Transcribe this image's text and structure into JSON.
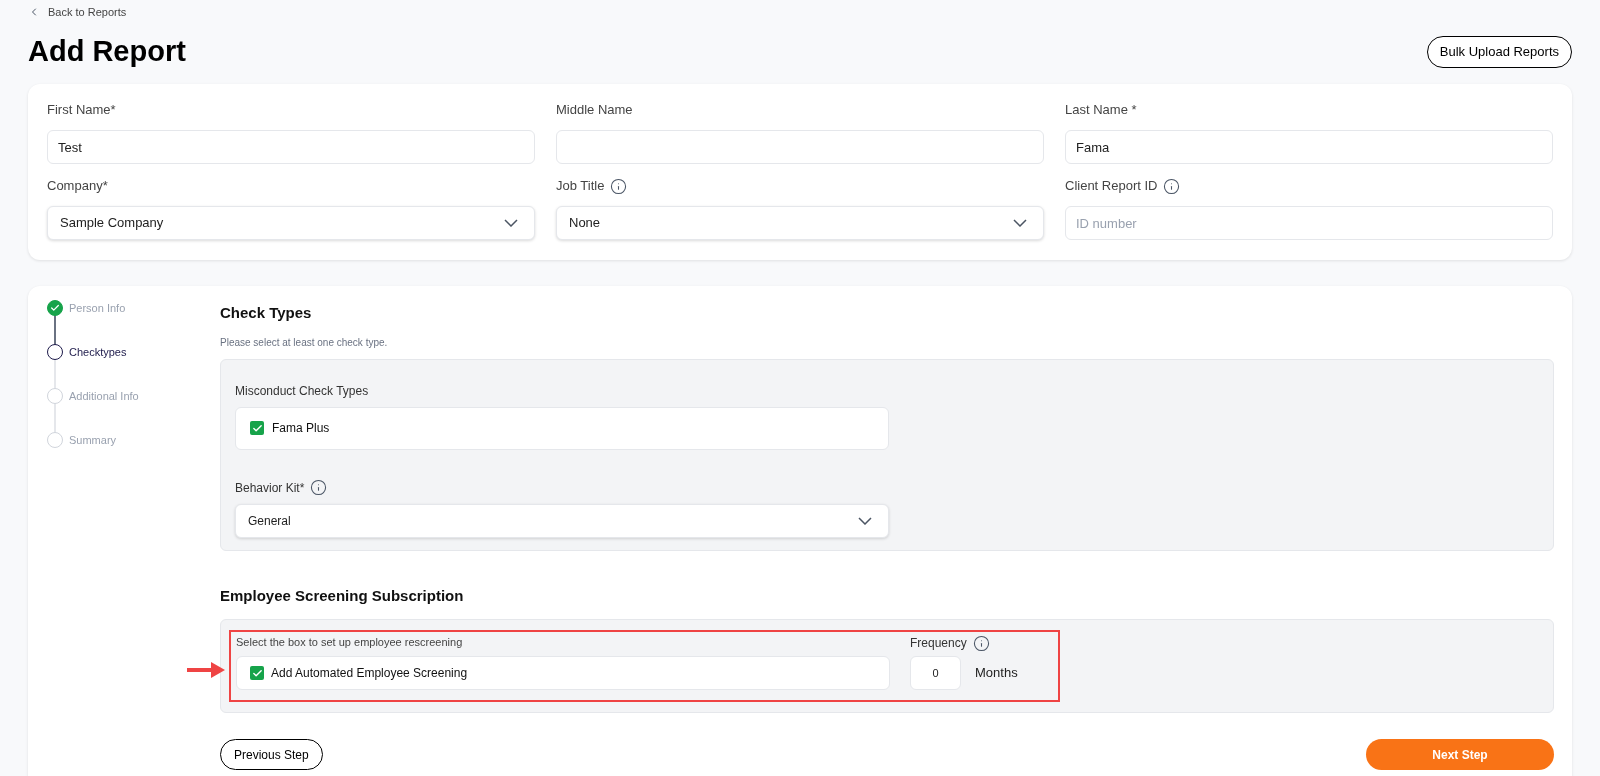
{
  "back_link": "Back to Reports",
  "title": "Add Report",
  "bulk_button": "Bulk Upload Reports",
  "person_fields": [
    {
      "label": "First Name*",
      "kind": "text",
      "value": "Test",
      "info": false
    },
    {
      "label": "Middle Name",
      "kind": "text",
      "info": false
    },
    {
      "label": "Last Name *",
      "kind": "text",
      "value": "Fama",
      "info": false
    },
    {
      "label": "Company*",
      "kind": "select",
      "value": "Sample Company",
      "info": false
    },
    {
      "label": "Job Title",
      "kind": "select",
      "value": "None",
      "info": true
    },
    {
      "label": "Client Report ID",
      "kind": "text",
      "placeholder": "ID number",
      "info": true
    }
  ],
  "steps": [
    {
      "label": "Person Info",
      "completed": true,
      "selected": false
    },
    {
      "label": "Checktypes",
      "completed": false,
      "selected": true
    },
    {
      "label": "Additional Info",
      "completed": false,
      "selected": false
    },
    {
      "label": "Summary",
      "completed": false,
      "selected": false
    }
  ],
  "check_types": {
    "heading": "Check Types",
    "hint": "Please select at least one check type.",
    "group_label": "Misconduct Check Types",
    "options": [
      {
        "label": "Fama Plus",
        "checked": true
      }
    ],
    "behavior_label": "Behavior Kit*",
    "behavior_value": "General"
  },
  "screening": {
    "heading": "Employee Screening Subscription",
    "instruction": "Select the box to set up employee rescreening",
    "option": {
      "label": "Add Automated Employee Screening",
      "checked": true
    },
    "frequency_label": "Frequency",
    "frequency_value": "0",
    "unit": "Months"
  },
  "buttons": {
    "previous": "Previous Step",
    "next": "Next Step"
  }
}
